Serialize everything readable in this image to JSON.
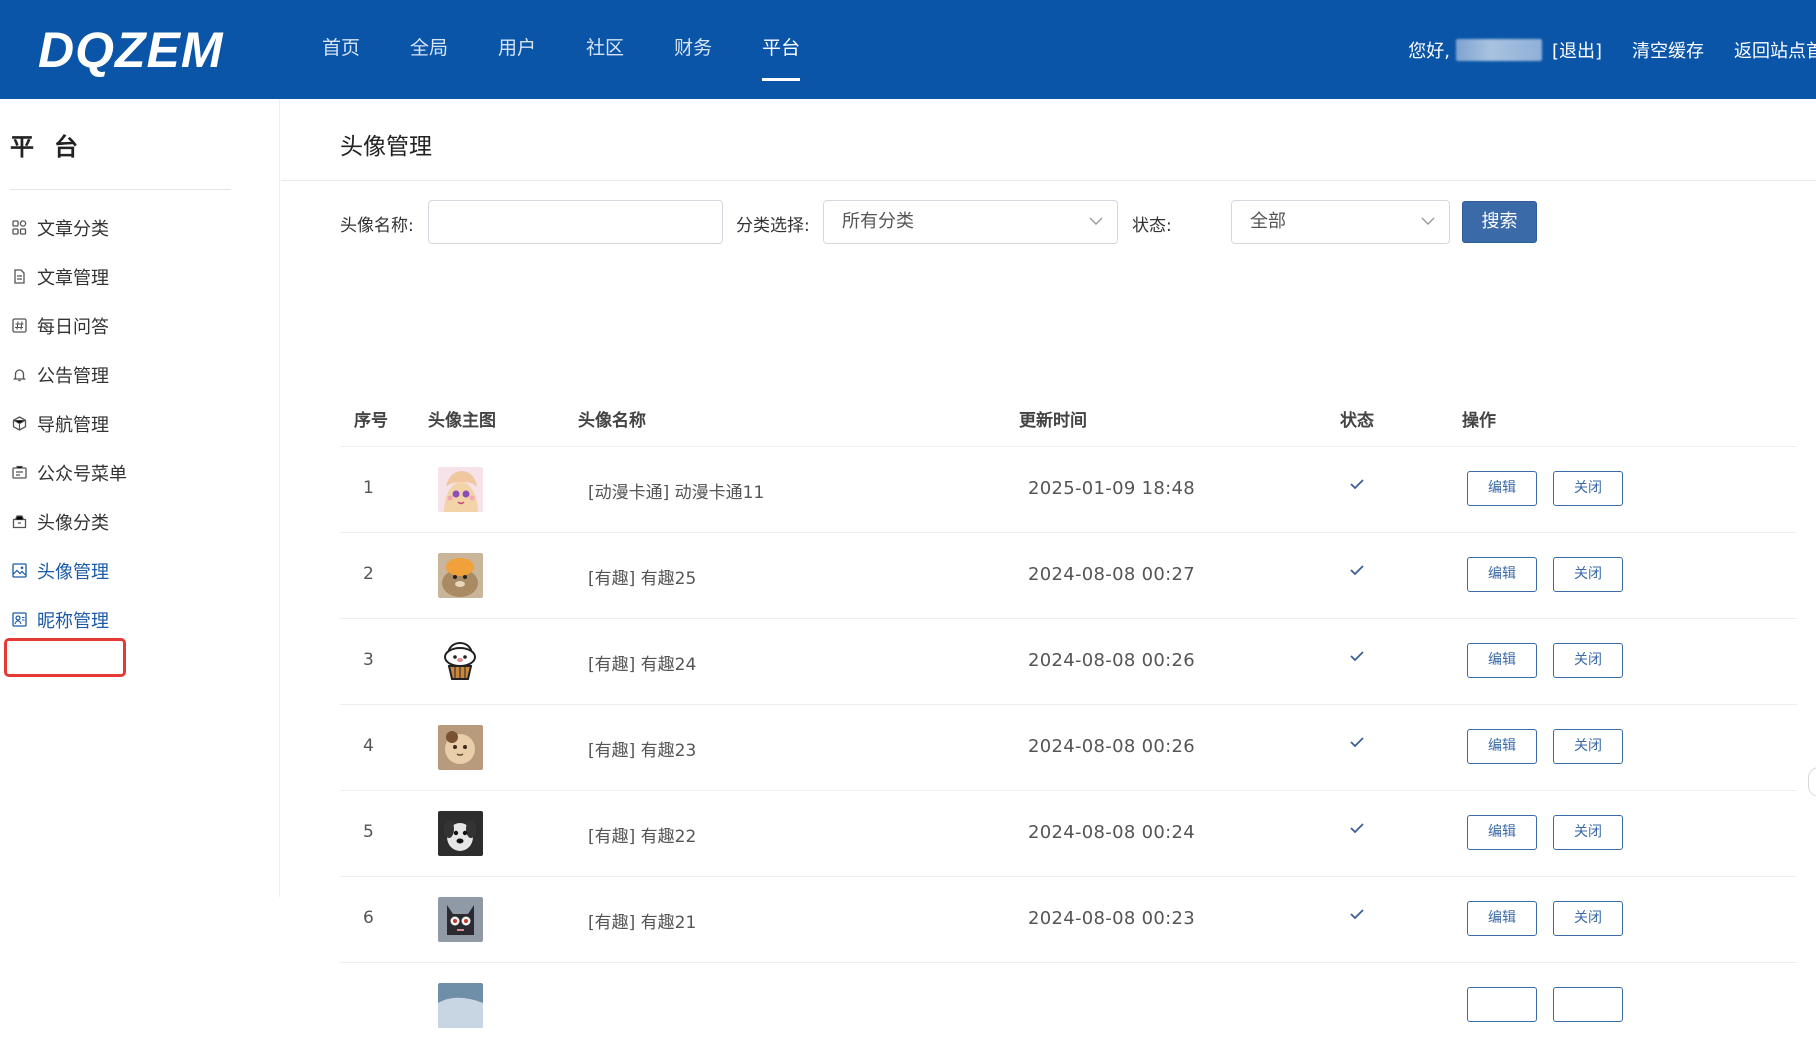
{
  "header": {
    "logo": "DQZEM",
    "nav": [
      {
        "label": "首页"
      },
      {
        "label": "全局"
      },
      {
        "label": "用户"
      },
      {
        "label": "社区"
      },
      {
        "label": "财务"
      },
      {
        "label": "平台"
      }
    ],
    "active_nav": "平台",
    "greeting": "您好,",
    "logout": "[退出]",
    "clear_cache": "清空缓存",
    "back_to_site": "返回站点首"
  },
  "sidebar": {
    "title": "平台",
    "items": [
      {
        "label": "文章分类",
        "icon": "grid-icon"
      },
      {
        "label": "文章管理",
        "icon": "document-icon"
      },
      {
        "label": "每日问答",
        "icon": "hash-icon"
      },
      {
        "label": "公告管理",
        "icon": "bell-icon"
      },
      {
        "label": "导航管理",
        "icon": "cube-icon"
      },
      {
        "label": "公众号菜单",
        "icon": "id-card-icon"
      },
      {
        "label": "头像分类",
        "icon": "folder-icon"
      },
      {
        "label": "头像管理",
        "icon": "image-icon"
      },
      {
        "label": "昵称管理",
        "icon": "user-card-icon"
      }
    ],
    "active_item": "头像管理"
  },
  "main": {
    "title": "头像管理",
    "filters": {
      "name_label": "头像名称:",
      "name_value": "",
      "category_label": "分类选择:",
      "category_value": "所有分类",
      "status_label": "状态:",
      "status_value": "全部",
      "search_button": "搜索"
    },
    "table": {
      "columns": [
        "序号",
        "头像主图",
        "头像名称",
        "更新时间",
        "状态",
        "操作"
      ],
      "rows": [
        {
          "index": "1",
          "name": "[动漫卡通] 动漫卡通11",
          "updated": "2025-01-09 18:48",
          "status": "enabled",
          "edit": "编辑",
          "close": "关闭"
        },
        {
          "index": "2",
          "name": "[有趣] 有趣25",
          "updated": "2024-08-08 00:27",
          "status": "enabled",
          "edit": "编辑",
          "close": "关闭"
        },
        {
          "index": "3",
          "name": "[有趣] 有趣24",
          "updated": "2024-08-08 00:26",
          "status": "enabled",
          "edit": "编辑",
          "close": "关闭"
        },
        {
          "index": "4",
          "name": "[有趣] 有趣23",
          "updated": "2024-08-08 00:26",
          "status": "enabled",
          "edit": "编辑",
          "close": "关闭"
        },
        {
          "index": "5",
          "name": "[有趣] 有趣22",
          "updated": "2024-08-08 00:24",
          "status": "enabled",
          "edit": "编辑",
          "close": "关闭"
        },
        {
          "index": "6",
          "name": "[有趣] 有趣21",
          "updated": "2024-08-08 00:23",
          "status": "enabled",
          "edit": "编辑",
          "close": "关闭"
        }
      ]
    }
  },
  "colors": {
    "header_bg": "#0a55a8",
    "accent": "#3a6aa7",
    "highlight": "#e53935"
  }
}
